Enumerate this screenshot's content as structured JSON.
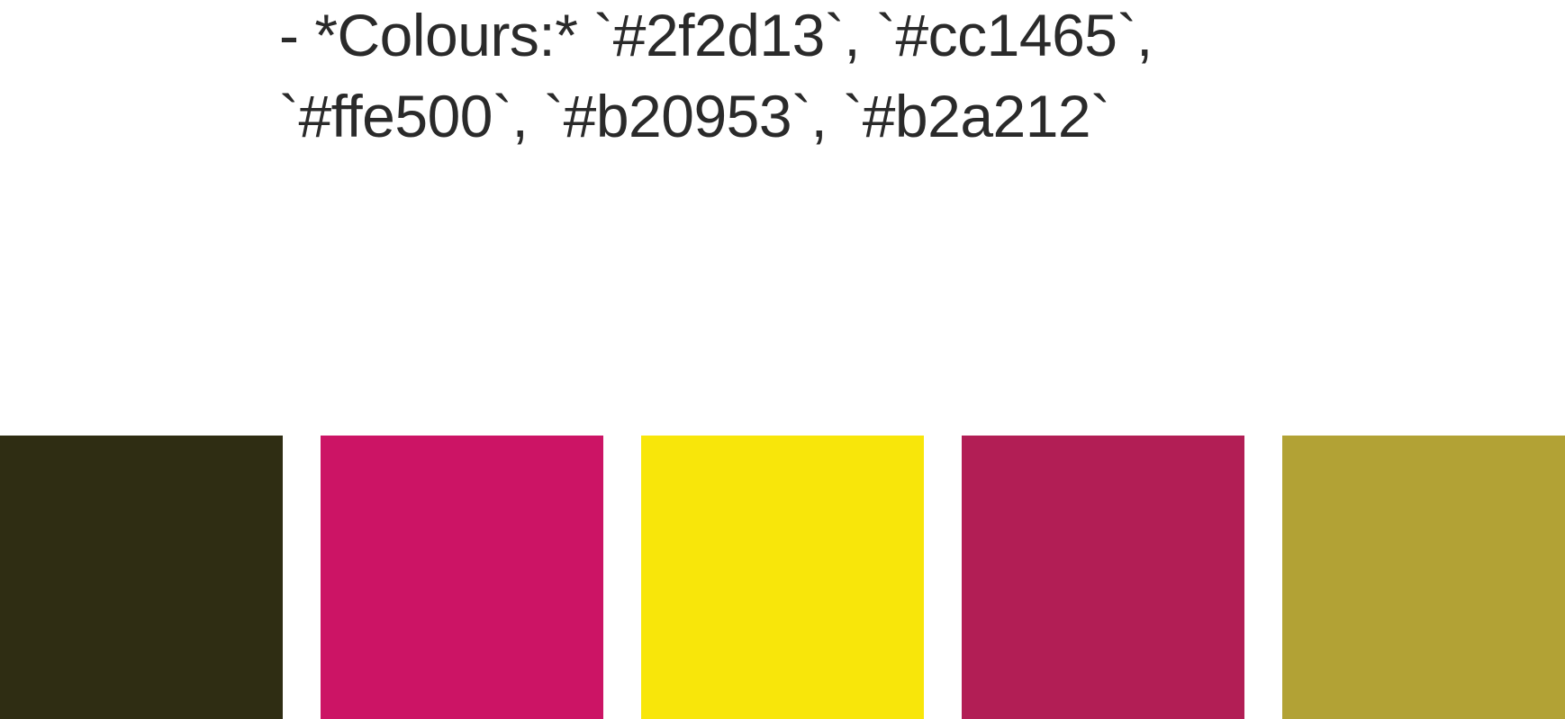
{
  "caption": {
    "text": "- *Colours:* `#2f2d13`, `#cc1465`, `#ffe500`, `#b20953`, `#b2a212`"
  },
  "swatches": [
    {
      "color": "#2f2d13"
    },
    {
      "color": "#cc1465"
    },
    {
      "color": "#f8e60a"
    },
    {
      "color": "#b21e55"
    },
    {
      "color": "#b2a235"
    }
  ]
}
